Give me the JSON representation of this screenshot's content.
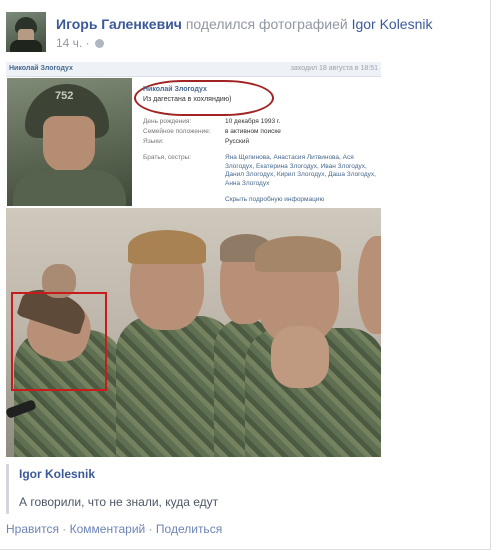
{
  "post": {
    "author": "Игорь Галенкевич",
    "action": "поделился фотографией",
    "target": "Igor Kolesnik",
    "time": "14 ч.",
    "separator": "·"
  },
  "vk": {
    "header_name": "Николай Злогодух",
    "header_time": "заходил 18 августа в 18:51",
    "helmet_number": "752",
    "name": "Николай Злогодух",
    "status": "Из дагестана в хохляндию)",
    "fields": [
      {
        "key": "День рождения:",
        "value": "10 декабря 1993 г."
      },
      {
        "key": "Семейное положение:",
        "value": "в активном поиске"
      },
      {
        "key": "Языки:",
        "value": "Русский"
      }
    ],
    "relatives_key": "Братья, сестры:",
    "relatives_value": "Яна Щепинова, Анастасия Литвинова, Ася Злогодух, Екатерина Злогодух, Иван Злогодух, Данил Злогодух, Кирил Злогодух, Даша Злогодух, Анна Злогодух",
    "more": "Скрыть подробную информацию"
  },
  "attribution": {
    "name": "Igor Kolesnik",
    "caption": "А говорили, что не знали, куда едут"
  },
  "actions": {
    "like": "Нравится",
    "comment": "Комментарий",
    "share": "Поделиться",
    "dot": "·"
  },
  "colors": {
    "link": "#3b5998",
    "muted": "#9197a3",
    "highlight": "#c81c1c"
  }
}
